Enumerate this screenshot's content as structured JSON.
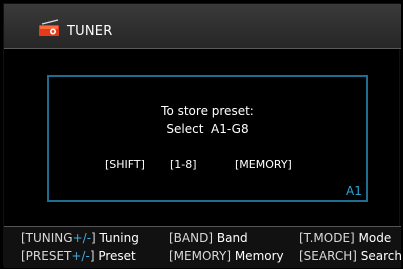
{
  "header": {
    "title": "TUNER",
    "icon": "radio-icon"
  },
  "dialog": {
    "line1": "To store preset:",
    "line2": "Select  A1-G8",
    "keys": [
      "[SHIFT]",
      "[1-8]",
      "[MEMORY]"
    ],
    "current_preset": "A1"
  },
  "footer": {
    "items": [
      {
        "key_prefix": "[TUNING",
        "key_accent": "+/-",
        "key_suffix": "]",
        "label": "Tuning"
      },
      {
        "key_prefix": "[BAND]",
        "key_accent": "",
        "key_suffix": "",
        "label": "Band"
      },
      {
        "key_prefix": "[T.MODE]",
        "key_accent": "",
        "key_suffix": "",
        "label": "Mode"
      },
      {
        "key_prefix": "[PRESET",
        "key_accent": "+/-",
        "key_suffix": "]",
        "label": "Preset"
      },
      {
        "key_prefix": "[MEMORY]",
        "key_accent": "",
        "key_suffix": "",
        "label": "Memory"
      },
      {
        "key_prefix": "[SEARCH]",
        "key_accent": "",
        "key_suffix": "",
        "label": "Search"
      }
    ]
  },
  "colors": {
    "accent": "#2aa6d6",
    "dialog_border": "#1e6e92",
    "background": "#000000",
    "header": "#2f2f2f"
  }
}
